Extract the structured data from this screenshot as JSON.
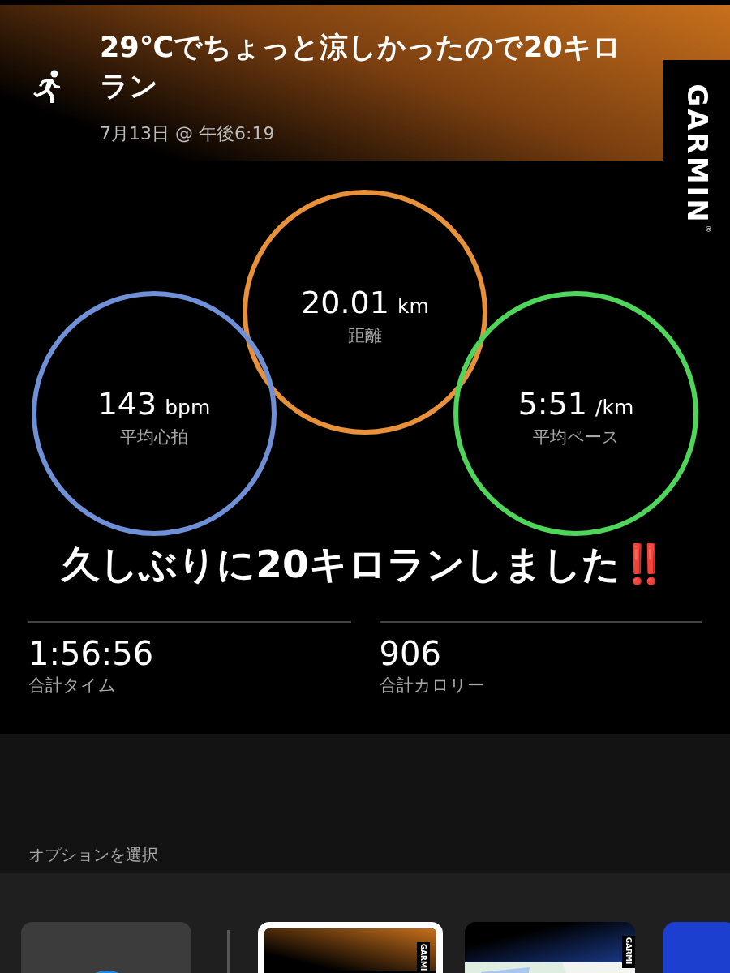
{
  "activity": {
    "title": "29℃でちょっと涼しかったので20キロラン",
    "date": "7月13日 @ 午後6:19"
  },
  "brand": {
    "label": "GARMIN",
    "mark": "®"
  },
  "rings": [
    {
      "value": "20.01",
      "unit": "km",
      "label": "距離",
      "color": "#e8913a"
    },
    {
      "value": "143",
      "unit": "bpm",
      "label": "平均心拍",
      "color": "#6f8fd6"
    },
    {
      "value": "5:51",
      "unit": "/km",
      "label": "平均ペース",
      "color": "#4fd65a"
    }
  ],
  "caption": "久しぶりに20キロランしました‼️",
  "stats": [
    {
      "value": "1:56:56",
      "label": "合計タイム"
    },
    {
      "value": "906",
      "label": "合計カロリー"
    }
  ],
  "options": {
    "heading": "オプションを選択",
    "templates": [
      {
        "kind": "blank",
        "selected": false
      },
      {
        "kind": "orange",
        "selected": true,
        "brand": "GARMI"
      },
      {
        "kind": "map",
        "selected": false,
        "brand": "GARMI"
      },
      {
        "kind": "blue",
        "selected": false
      }
    ]
  }
}
